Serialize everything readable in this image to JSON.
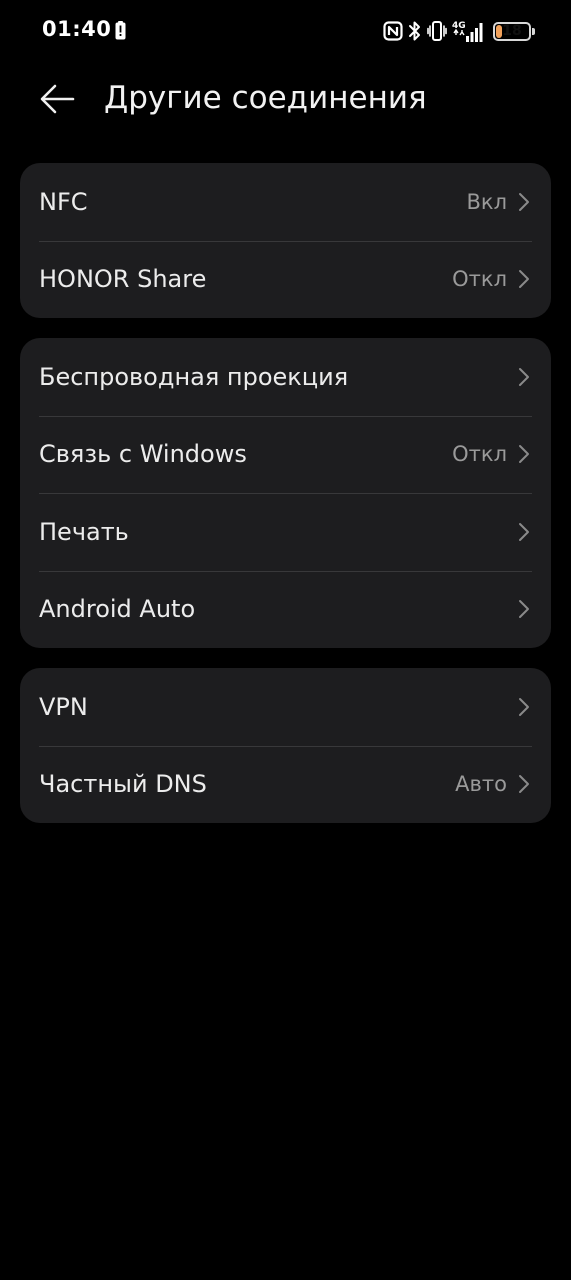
{
  "status_bar": {
    "time": "01:40",
    "battery_level": "18",
    "battery_fraction": 0.18,
    "network_label": "4G",
    "icons": [
      "alert-icon",
      "nfc-icon",
      "bluetooth-icon",
      "vibrate-icon",
      "signal-icon",
      "battery-icon"
    ],
    "battery_color": "#f1a15b"
  },
  "header": {
    "back_icon": "arrow-left-icon",
    "title": "Другие соединения"
  },
  "groups": [
    {
      "items": [
        {
          "label": "NFC",
          "value": "Вкл"
        },
        {
          "label": "HONOR Share",
          "value": "Откл"
        }
      ]
    },
    {
      "items": [
        {
          "label": "Беспроводная проекция",
          "value": ""
        },
        {
          "label": "Связь с Windows",
          "value": "Откл"
        },
        {
          "label": "Печать",
          "value": ""
        },
        {
          "label": "Android Auto",
          "value": ""
        }
      ]
    },
    {
      "items": [
        {
          "label": "VPN",
          "value": ""
        },
        {
          "label": "Частный DNS",
          "value": "Авто"
        }
      ]
    }
  ],
  "colors": {
    "background": "#000000",
    "card": "#1d1d1f",
    "divider": "#38383a",
    "text_primary": "#ececec",
    "text_secondary": "#9a9a9a"
  }
}
